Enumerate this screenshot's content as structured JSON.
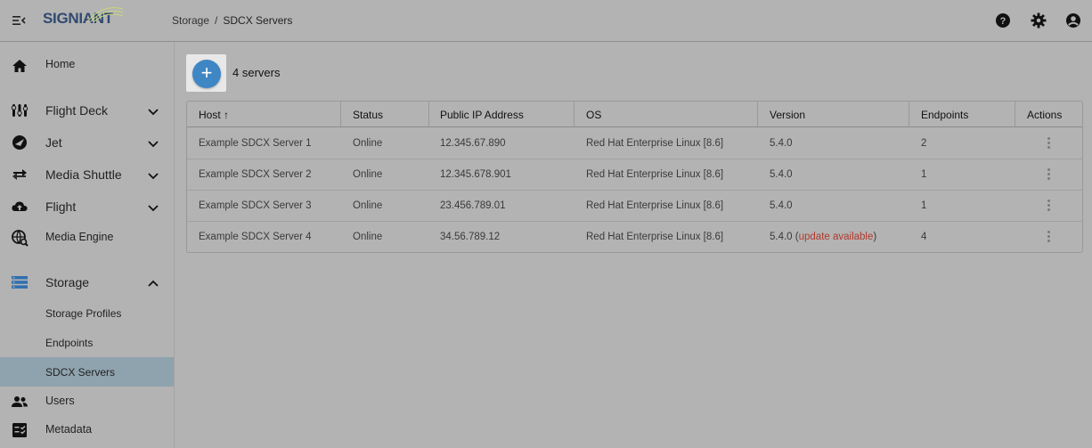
{
  "header": {
    "logo_text": "SIGNIANT",
    "breadcrumb": {
      "parent": "Storage",
      "separator": "/",
      "current": "SDCX Servers"
    }
  },
  "sidebar": {
    "items": [
      {
        "label": "Home",
        "icon": "home-icon"
      },
      {
        "label": "Flight Deck",
        "icon": "flight-deck-icon"
      },
      {
        "label": "Jet",
        "icon": "jet-icon"
      },
      {
        "label": "Media Shuttle",
        "icon": "media-shuttle-icon"
      },
      {
        "label": "Flight",
        "icon": "cloud-upload-icon"
      },
      {
        "label": "Media Engine",
        "icon": "media-engine-icon"
      },
      {
        "label": "Storage",
        "icon": "storage-icon"
      },
      {
        "label": "Storage Profiles"
      },
      {
        "label": "Endpoints"
      },
      {
        "label": "SDCX Servers"
      },
      {
        "label": "Users",
        "icon": "users-icon"
      },
      {
        "label": "Metadata",
        "icon": "metadata-icon"
      }
    ]
  },
  "main": {
    "server_count": "4 servers",
    "table": {
      "columns": [
        "Host",
        "Status",
        "Public IP Address",
        "OS",
        "Version",
        "Endpoints",
        "Actions"
      ],
      "sort_indicator": "↑",
      "rows": [
        {
          "host": "Example SDCX Server 1",
          "status": "Online",
          "ip": "12.345.67.890",
          "os": "Red Hat Enterprise Linux [8.6]",
          "version": "5.4.0",
          "version_note": "",
          "endpoints": "2"
        },
        {
          "host": "Example SDCX Server 2",
          "status": "Online",
          "ip": "12.345.678.901",
          "os": "Red Hat Enterprise Linux [8.6]",
          "version": "5.4.0",
          "version_note": "",
          "endpoints": "1"
        },
        {
          "host": "Example SDCX Server 3",
          "status": "Online",
          "ip": "23.456.789.01",
          "os": "Red Hat Enterprise Linux [8.6]",
          "version": "5.4.0",
          "version_note": "",
          "endpoints": "1"
        },
        {
          "host": "Example SDCX Server 4",
          "status": "Online",
          "ip": "34.56.789.12",
          "os": "Red Hat Enterprise Linux [8.6]",
          "version": "5.4.0",
          "version_note": "update available",
          "endpoints": "4"
        }
      ]
    }
  },
  "colors": {
    "accent": "#3f86c4",
    "active_nav": "#8fa3ae",
    "warning": "#b03a2e"
  }
}
